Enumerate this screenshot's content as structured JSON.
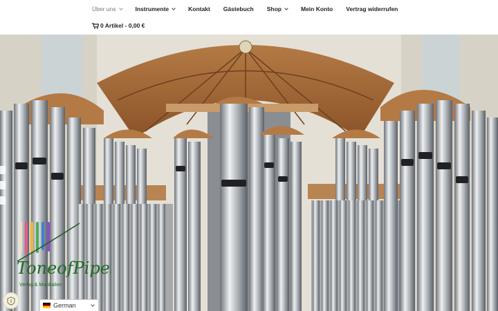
{
  "nav": {
    "items": [
      {
        "label": "Über uns",
        "has_dropdown": true,
        "active": true
      },
      {
        "label": "Instrumente",
        "has_dropdown": true,
        "active": false
      },
      {
        "label": "Kontakt",
        "has_dropdown": false,
        "active": false
      },
      {
        "label": "Gästebuch",
        "has_dropdown": false,
        "active": false
      },
      {
        "label": "Shop",
        "has_dropdown": true,
        "active": false
      },
      {
        "label": "Mein Konto",
        "has_dropdown": false,
        "active": false
      },
      {
        "label": "Vertrag widerrufen",
        "has_dropdown": false,
        "active": false
      }
    ]
  },
  "cart": {
    "label": "0 Artikel - 0,00 €",
    "icon": "shopping-cart-icon"
  },
  "hero": {
    "subject": "pipe-organ-in-church"
  },
  "logo": {
    "text": "ToneofPipes",
    "tagline": "Verlag & Musikalien"
  },
  "language": {
    "selected": "German",
    "flag": "de-flag-icon"
  },
  "colors": {
    "accent_wood": "#a8683a",
    "pipe_silver": "#c9ccd0",
    "text_dark": "#222222",
    "text_muted": "#767676"
  }
}
